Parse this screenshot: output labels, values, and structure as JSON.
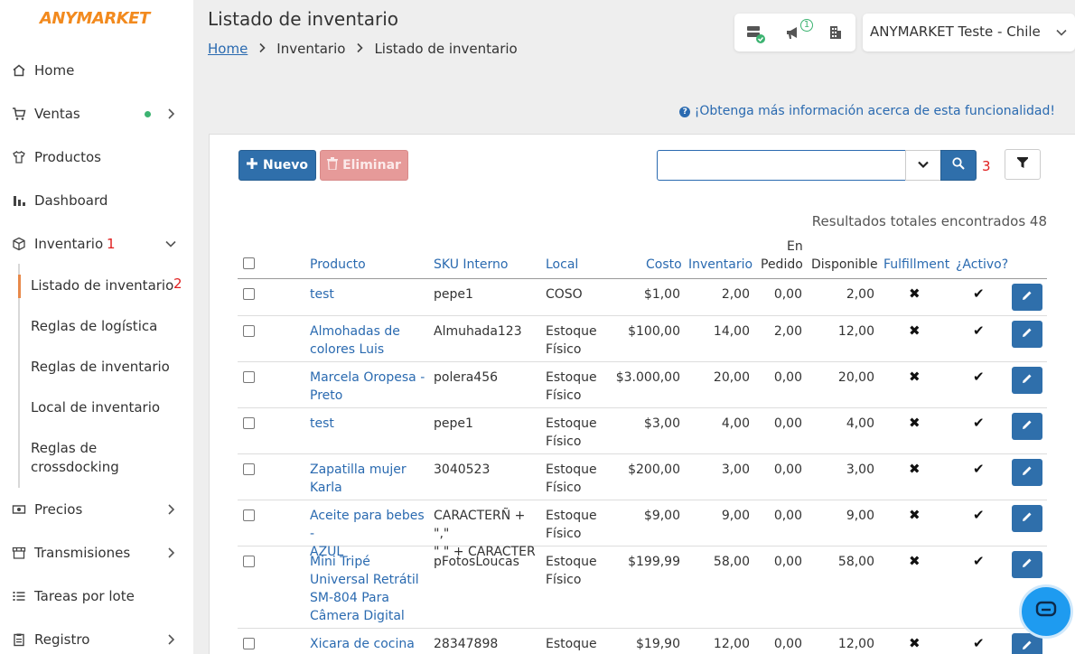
{
  "brand": {
    "logo_text": "ANYMARKET",
    "accent": "#f28a1e",
    "primary": "#2f6fab"
  },
  "sidebar": {
    "items": [
      {
        "label": "Home",
        "icon": "home-icon"
      },
      {
        "label": "Ventas",
        "icon": "cart-icon"
      },
      {
        "label": "Productos",
        "icon": "shirt-icon"
      },
      {
        "label": "Dashboard",
        "icon": "bar-chart-icon"
      },
      {
        "label": "Inventario",
        "icon": "box-icon"
      },
      {
        "label": "Precios",
        "icon": "money-icon"
      },
      {
        "label": "Transmisiones",
        "icon": "store-icon"
      },
      {
        "label": "Tareas por lote",
        "icon": "list-icon"
      },
      {
        "label": "Registro",
        "icon": "clipboard-icon"
      }
    ],
    "inventario_sub": [
      {
        "label": "Listado de inventario"
      },
      {
        "label": "Reglas de logística"
      },
      {
        "label": "Reglas de inventario"
      },
      {
        "label": "Local de inventario"
      },
      {
        "label": "Reglas de crossdocking"
      }
    ],
    "annotations": {
      "inventario": "1",
      "listado": "2"
    }
  },
  "header": {
    "title": "Listado de inventario",
    "breadcrumb": {
      "home": "Home",
      "section": "Inventario",
      "current": "Listado de inventario"
    },
    "notification_count": "1",
    "account_name": "ANYMARKET Teste - Chile"
  },
  "info_link": "¡Obtenga más información acerca de esta funcionalidad!",
  "toolbar": {
    "new_label": "Nuevo",
    "delete_label": "Eliminar",
    "search_value": "",
    "search_annotation": "3"
  },
  "results_text": "Resultados totales encontrados 48",
  "table": {
    "headers": {
      "producto": "Producto",
      "sku": "SKU Interno",
      "local": "Local",
      "costo": "Costo",
      "inventario": "Inventario",
      "en_pedido_1": "En",
      "en_pedido_2": "Pedido",
      "disponible": "Disponible",
      "fulfillment": "Fulfillment",
      "activo": "¿Activo?"
    },
    "rows": [
      {
        "producto": [
          "test"
        ],
        "sku": [
          "pepe1"
        ],
        "local": [
          "COSO"
        ],
        "costo": "$1,00",
        "inventario": "2,00",
        "en_pedido": "0,00",
        "disponible": "2,00",
        "fulfillment": "✖",
        "activo": "✔"
      },
      {
        "producto": [
          "Almohadas de",
          "colores Luis"
        ],
        "sku": [
          "Almuhada123"
        ],
        "local": [
          "Estoque",
          "Físico"
        ],
        "costo": "$100,00",
        "inventario": "14,00",
        "en_pedido": "2,00",
        "disponible": "12,00",
        "fulfillment": "✖",
        "activo": "✔"
      },
      {
        "producto": [
          "Marcela Oropesa -",
          "Preto"
        ],
        "sku": [
          "polera456"
        ],
        "local": [
          "Estoque",
          "Físico"
        ],
        "costo": "$3.000,00",
        "inventario": "20,00",
        "en_pedido": "0,00",
        "disponible": "20,00",
        "fulfillment": "✖",
        "activo": "✔"
      },
      {
        "producto": [
          "test"
        ],
        "sku": [
          "pepe1"
        ],
        "local": [
          "Estoque",
          "Físico"
        ],
        "costo": "$3,00",
        "inventario": "4,00",
        "en_pedido": "0,00",
        "disponible": "4,00",
        "fulfillment": "✖",
        "activo": "✔"
      },
      {
        "producto": [
          "Zapatilla mujer",
          "Karla"
        ],
        "sku": [
          "3040523"
        ],
        "local": [
          "Estoque",
          "Físico"
        ],
        "costo": "$200,00",
        "inventario": "3,00",
        "en_pedido": "0,00",
        "disponible": "3,00",
        "fulfillment": "✖",
        "activo": "✔"
      },
      {
        "producto": [
          "Aceite para bebes -",
          "AZUL"
        ],
        "sku": [
          "CARACTERÑ + \",\"",
          "\" \" + CARACTER"
        ],
        "local": [
          "Estoque",
          "Físico"
        ],
        "costo": "$9,00",
        "inventario": "9,00",
        "en_pedido": "0,00",
        "disponible": "9,00",
        "fulfillment": "✖",
        "activo": "✔"
      },
      {
        "producto": [
          "Mini Tripé",
          "Universal Retrátil",
          "SM-804 Para",
          "Câmera Digital"
        ],
        "sku": [
          "pFotosLoucas"
        ],
        "local": [
          "Estoque",
          "Físico"
        ],
        "costo": "$199,99",
        "inventario": "58,00",
        "en_pedido": "0,00",
        "disponible": "58,00",
        "fulfillment": "✖",
        "activo": "✔"
      },
      {
        "producto": [
          "Xicara de cocina"
        ],
        "sku": [
          "28347898"
        ],
        "local": [
          "Estoque"
        ],
        "costo": "$19,90",
        "inventario": "12,00",
        "en_pedido": "0,00",
        "disponible": "12,00",
        "fulfillment": "✖",
        "activo": "✔"
      }
    ]
  }
}
